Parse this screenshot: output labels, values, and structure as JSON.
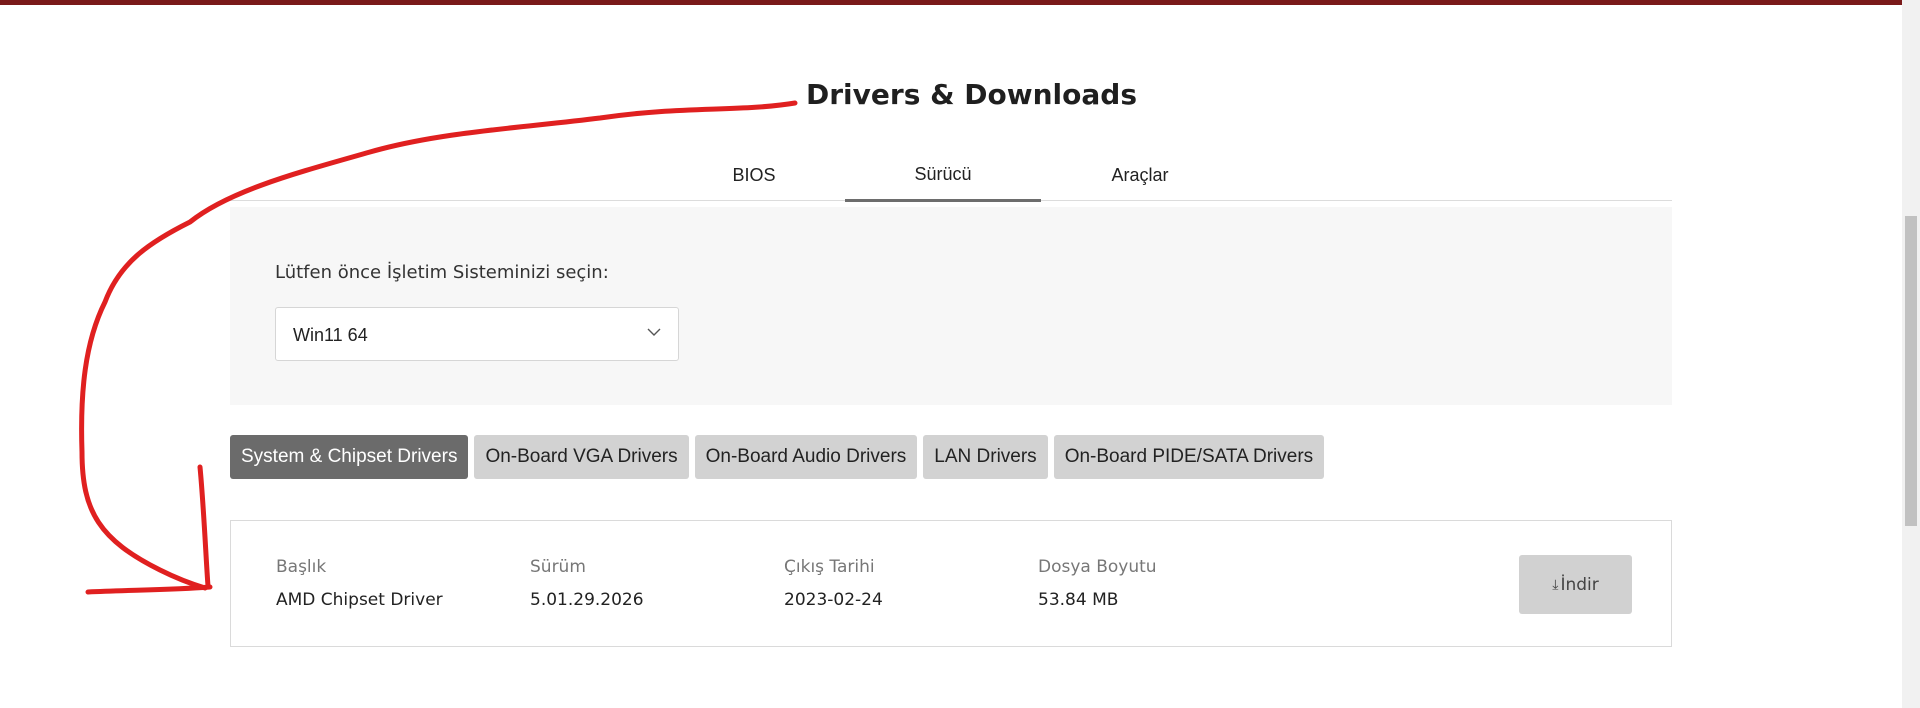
{
  "page": {
    "title": "Drivers & Downloads"
  },
  "tabs": [
    {
      "label": "BIOS",
      "active": false
    },
    {
      "label": "Sürücü",
      "active": true
    },
    {
      "label": "Araçlar",
      "active": false
    }
  ],
  "os_selector": {
    "label": "Lütfen önce İşletim Sisteminizi seçin:",
    "selected": "Win11 64",
    "icon": "chevron-down-icon"
  },
  "categories": [
    {
      "label": "System & Chipset Drivers",
      "active": true
    },
    {
      "label": "On-Board VGA Drivers",
      "active": false
    },
    {
      "label": "On-Board Audio Drivers",
      "active": false
    },
    {
      "label": "LAN Drivers",
      "active": false
    },
    {
      "label": "On-Board PIDE/SATA Drivers",
      "active": false
    }
  ],
  "driver": {
    "columns": {
      "title": "Başlık",
      "version": "Sürüm",
      "release_date": "Çıkış Tarihi",
      "file_size": "Dosya Boyutu"
    },
    "title": "AMD Chipset Driver",
    "version": "5.01.29.2026",
    "release_date": "2023-02-24",
    "file_size": "53.84 MB",
    "download_label": "İndir",
    "download_icon": "download-arrow-icon"
  },
  "colors": {
    "top_bar": "#7a1a1a",
    "active_category": "#6b6b6b",
    "annotation": "#e02020"
  }
}
